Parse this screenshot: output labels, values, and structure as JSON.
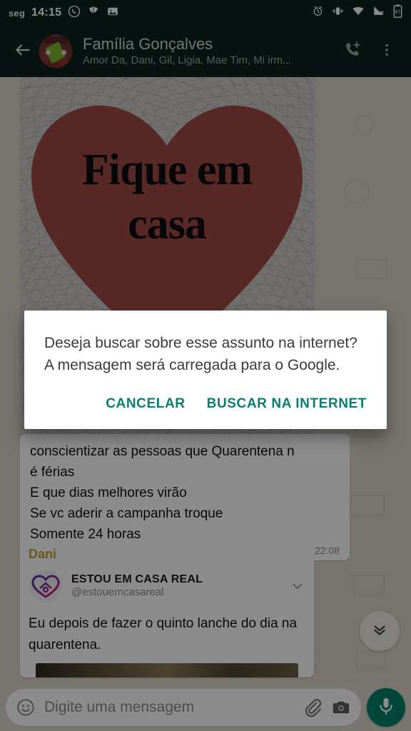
{
  "status_bar": {
    "day": "seg",
    "time": "14:15",
    "left_icons": [
      "whatsapp-icon",
      "leaf-icon",
      "image-icon"
    ],
    "right_icons": [
      "alarm-icon",
      "vibrate-icon",
      "wifi-icon",
      "signal-no-service-icon",
      "battery-icon"
    ],
    "battery_level": "87"
  },
  "header": {
    "back_label": "back-arrow",
    "title": "Família Gonçalves",
    "subtitle": "Amor Da, Dani, Gil, Ligia, Mae Tim, Mi irm...",
    "actions": [
      "add-call-icon",
      "overflow-menu-icon"
    ]
  },
  "chat": {
    "image_message": {
      "poster_line1": "Fique em",
      "poster_line2": "casa",
      "heart_color": "#9d4b47",
      "poster_bg": "#cfcdc8"
    },
    "text_message": {
      "body": "conscientizar as pessoas que Quarentena n\né férias\nE que dias melhores virão\nSe vc aderir a campanha troque\nSomente 24 horas",
      "time": "22:08"
    },
    "dani_message": {
      "sender": "Dani",
      "sender_color": "#c9a227",
      "preview_title": "ESTOU EM CASA REAL",
      "preview_handle": "@estouemcasareal",
      "preview_expand_icon": "chevron-down-icon",
      "preview_body": "Eu depois de fazer o quinto lanche do dia na quarentena."
    },
    "scroll_fab_icon": "double-chevron-down-icon"
  },
  "input_bar": {
    "emoji_icon": "emoji-smiley-icon",
    "placeholder": "Digite uma mensagem",
    "value": "",
    "attach_icon": "paperclip-icon",
    "camera_icon": "camera-icon",
    "mic_icon": "microphone-icon",
    "mic_color": "#008069"
  },
  "dialog": {
    "message": "Deseja buscar sobre esse assunto na internet? A mensagem será carregada para o Google.",
    "cancel_label": "CANCELAR",
    "confirm_label": "BUSCAR NA INTERNET",
    "accent_color": "#0a7d6e"
  }
}
